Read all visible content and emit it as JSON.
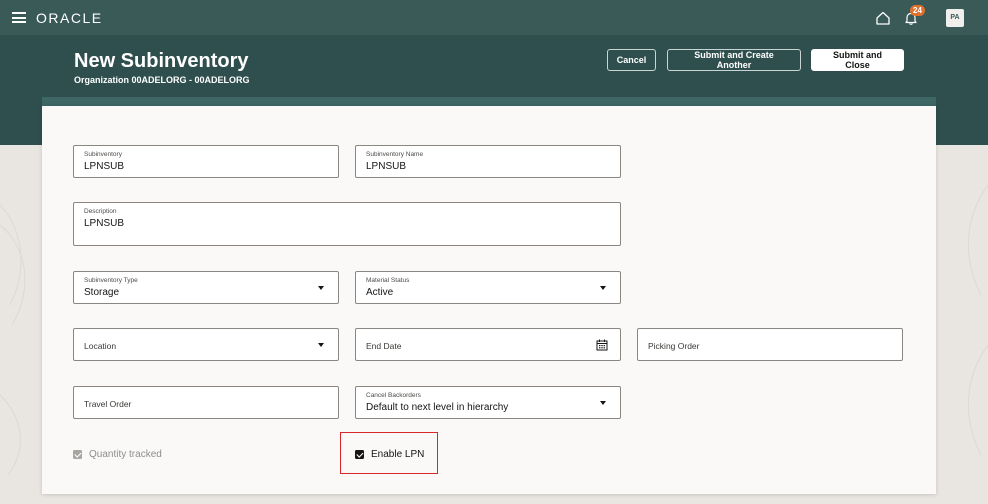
{
  "app": {
    "logo_text": "ORACLE",
    "notification_count": "24",
    "user_initials": "PA"
  },
  "header": {
    "title": "New Subinventory",
    "organization": "Organization 00ADELORG - 00ADELORG",
    "buttons": {
      "cancel": "Cancel",
      "submit_create_another": "Submit and Create Another",
      "submit_close": "Submit and Close"
    }
  },
  "form": {
    "subinventory": {
      "label": "Subinventory",
      "value": "LPNSUB"
    },
    "subinventory_name": {
      "label": "Subinventory Name",
      "value": "LPNSUB"
    },
    "description": {
      "label": "Description",
      "value": "LPNSUB"
    },
    "subinventory_type": {
      "label": "Subinventory Type",
      "value": "Storage"
    },
    "material_status": {
      "label": "Material Status",
      "value": "Active"
    },
    "location": {
      "label": "Location",
      "value": ""
    },
    "end_date": {
      "label": "End Date",
      "value": ""
    },
    "picking_order": {
      "label": "Picking Order",
      "value": ""
    },
    "travel_order": {
      "label": "Travel Order",
      "value": ""
    },
    "cancel_backorders": {
      "label": "Cancel Backorders",
      "value": "Default to next level in hierarchy"
    },
    "quantity_tracked": {
      "label": "Quantity tracked",
      "checked": true,
      "disabled": true
    },
    "enable_lpn": {
      "label": "Enable LPN",
      "checked": true
    }
  },
  "colors": {
    "brand_header": "#2f4f4e",
    "top_bar": "#3a5a58",
    "badge": "#e0702e",
    "highlight": "#d9262a"
  }
}
